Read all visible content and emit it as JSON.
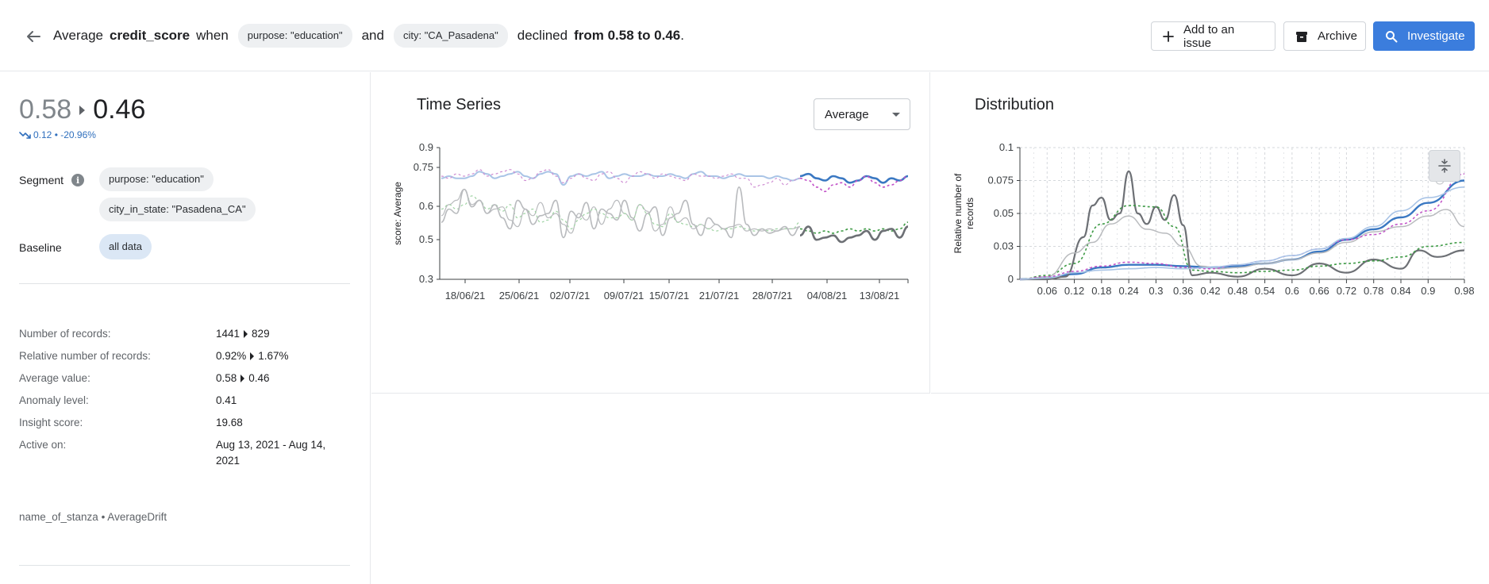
{
  "header": {
    "prefix": "Average",
    "metric": "credit_score",
    "when": "when",
    "chip1": "purpose: \"education\"",
    "and": "and",
    "chip2": "city: \"CA_Pasadena\"",
    "declined": "declined",
    "change": "from 0.58 to 0.46",
    "period": ".",
    "actions": {
      "add_issue": "Add to an issue",
      "archive": "Archive",
      "investigate": "Investigate"
    }
  },
  "summary": {
    "old_value": "0.58",
    "new_value": "0.46",
    "delta": "0.12 • -20.96%",
    "segment_label": "Segment",
    "segment_info_icon": "info-icon",
    "segments": [
      "purpose: \"education\"",
      "city_in_state: \"Pasadena_CA\""
    ],
    "baseline_label": "Baseline",
    "baseline": "all data"
  },
  "stats": {
    "records_label": "Number of records:",
    "records_old": "1441",
    "records_new": "829",
    "relative_label": "Relative number of records:",
    "relative_old": "0.92%",
    "relative_new": "1.67%",
    "avg_label": "Average value:",
    "avg_old": "0.58",
    "avg_new": "0.46",
    "anomaly_label": "Anomaly level:",
    "anomaly": "0.41",
    "insight_label": "Insight score:",
    "insight": "19.68",
    "active_label": "Active on:",
    "active": "Aug 13, 2021 - Aug 14, 2021"
  },
  "stanza": "name_of_stanza • AverageDrift",
  "colors": {
    "accent": "#3b7ddd",
    "segment_line": "#3a78c2",
    "baseline_line": "#a9c4e6",
    "magenta": "#c14fc7",
    "green": "#3f9b46",
    "gray": "#6d7075",
    "lightgray": "#b9bbbe"
  },
  "chart_data": [
    {
      "type": "line",
      "title": "Time Series",
      "aggregation": "Average",
      "ylabel": "score: Average",
      "ylim": [
        0.3,
        0.9
      ],
      "yticks": [
        "0.3",
        "0.5",
        "0.6",
        "0.75",
        "0.9"
      ],
      "ytick_values": [
        0.3,
        0.5,
        0.6,
        0.75,
        0.9
      ],
      "xticks": [
        "18/06/21",
        "25/06/21",
        "02/07/21",
        "09/07/21",
        "15/07/21",
        "21/07/21",
        "28/07/21",
        "04/08/21",
        "13/08/21"
      ],
      "x_start": "2021-06-15",
      "x_end": "2021-08-15",
      "grid": false,
      "series": [
        {
          "style": "baseline-avg",
          "values": [
            0.76,
            0.77,
            0.76,
            0.76,
            0.77,
            0.79,
            0.78,
            0.76,
            0.77,
            0.78,
            0.79,
            0.77,
            0.76,
            0.78,
            0.79,
            0.78,
            0.73,
            0.77,
            0.78,
            0.77,
            0.78,
            0.79,
            0.76,
            0.77,
            0.78,
            0.77,
            0.77,
            0.78,
            0.77,
            0.77,
            0.78,
            0.77,
            0.76,
            0.78,
            0.79,
            0.77,
            0.77,
            0.76,
            0.77,
            0.78,
            0.77,
            0.77,
            0.77,
            0.76,
            0.77,
            0.76,
            0.75,
            0.76
          ]
        },
        {
          "style": "segment-avg",
          "values": [
            0.77,
            0.76,
            0.78,
            0.77,
            0.78,
            0.8,
            0.77,
            0.78,
            0.79,
            0.8,
            0.78,
            0.75,
            0.76,
            0.79,
            0.8,
            0.77,
            0.74,
            0.76,
            0.78,
            0.76,
            0.75,
            0.78,
            0.79,
            0.76,
            0.74,
            0.77,
            0.79,
            0.78,
            0.76,
            0.78,
            0.77,
            0.76,
            0.75,
            0.78,
            0.77,
            0.77,
            0.76,
            0.77,
            0.78,
            0.76,
            0.76,
            0.72,
            0.73,
            0.74,
            0.76,
            0.73,
            0.75,
            0.76
          ]
        },
        {
          "style": "baseline-count",
          "values": [
            0.59,
            0.64,
            0.66,
            0.71,
            0.64,
            0.66,
            0.6,
            0.62,
            0.63,
            0.57,
            0.54,
            0.62,
            0.59,
            0.65,
            0.58,
            0.6,
            0.55,
            0.51,
            0.6,
            0.57,
            0.63,
            0.55,
            0.62,
            0.66,
            0.6,
            0.57,
            0.64,
            0.61,
            0.52,
            0.55,
            0.63,
            0.56,
            0.58,
            0.53,
            0.55,
            0.53,
            0.55,
            0.53,
            0.54,
            0.55,
            0.52,
            0.53,
            0.52,
            0.53,
            0.52,
            0.53,
            0.53,
            0.54
          ]
        },
        {
          "style": "segment-count",
          "values": [
            0.62,
            0.64,
            0.62,
            0.64,
            0.68,
            0.66,
            0.62,
            0.64,
            0.61,
            0.64,
            0.58,
            0.6,
            0.62,
            0.56,
            0.57,
            0.61,
            0.57,
            0.53,
            0.57,
            0.6,
            0.62,
            0.6,
            0.58,
            0.58,
            0.6,
            0.57,
            0.64,
            0.6,
            0.55,
            0.54,
            0.6,
            0.56,
            0.55,
            0.54,
            0.55,
            0.53,
            0.52,
            0.53,
            0.53,
            0.54,
            0.53,
            0.52,
            0.53,
            0.52,
            0.53,
            0.53,
            0.53,
            0.56
          ]
        },
        {
          "style": "baseline-gray",
          "values": [
            0.56,
            0.62,
            0.6,
            0.71,
            0.63,
            0.66,
            0.6,
            0.64,
            0.58,
            0.53,
            0.66,
            0.62,
            0.55,
            0.59,
            0.6,
            0.66,
            0.49,
            0.61,
            0.58,
            0.65,
            0.53,
            0.62,
            0.6,
            0.57,
            0.66,
            0.58,
            0.52,
            0.6,
            0.63,
            0.5,
            0.58,
            0.6,
            0.66,
            0.55,
            0.5,
            0.58,
            0.55,
            0.53,
            0.49,
            0.72,
            0.55,
            0.5,
            0.53,
            0.51,
            0.52,
            0.54,
            0.5,
            0.54
          ]
        }
      ],
      "recent": [
        {
          "style": "recent-avg",
          "values": [
            0.77,
            0.78,
            0.76,
            0.75,
            0.77,
            0.76,
            0.74,
            0.75,
            0.77,
            0.76,
            0.74,
            0.76,
            0.75,
            0.77
          ]
        },
        {
          "style": "recent-magenta",
          "values": [
            0.76,
            0.75,
            0.72,
            0.7,
            0.73,
            0.74,
            0.72,
            0.75,
            0.77,
            0.74,
            0.72,
            0.73,
            0.75,
            0.77
          ]
        },
        {
          "style": "recent-green",
          "values": [
            0.53,
            0.52,
            0.51,
            0.52,
            0.51,
            0.52,
            0.53,
            0.52,
            0.53,
            0.52,
            0.53,
            0.52,
            0.53,
            0.56
          ]
        },
        {
          "style": "recent-gray",
          "values": [
            0.5,
            0.54,
            0.48,
            0.49,
            0.5,
            0.47,
            0.49,
            0.5,
            0.52,
            0.48,
            0.52,
            0.53,
            0.49,
            0.54
          ]
        }
      ]
    },
    {
      "type": "line",
      "title": "Distribution",
      "ylabel": "Relative number of records",
      "ylim": [
        0,
        0.1
      ],
      "yticks": [
        "0",
        "0.03",
        "0.05",
        "0.075",
        "0.1"
      ],
      "ytick_values": [
        0,
        0.025,
        0.05,
        0.075,
        0.1
      ],
      "xticks": [
        "0.06",
        "0.12",
        "0.18",
        "0.24",
        "0.3",
        "0.36",
        "0.42",
        "0.48",
        "0.54",
        "0.6",
        "0.66",
        "0.72",
        "0.78",
        "0.84",
        "0.9",
        "0.98"
      ],
      "xtick_values": [
        0.06,
        0.12,
        0.18,
        0.24,
        0.3,
        0.36,
        0.42,
        0.48,
        0.54,
        0.6,
        0.66,
        0.72,
        0.78,
        0.84,
        0.9,
        0.98
      ],
      "xlim": [
        0.0,
        0.98
      ],
      "grid": true,
      "zoom_icon": "zoom-icon",
      "series": [
        {
          "style": "blue",
          "x": [
            0.0,
            0.06,
            0.12,
            0.18,
            0.24,
            0.3,
            0.36,
            0.42,
            0.48,
            0.54,
            0.6,
            0.66,
            0.72,
            0.78,
            0.84,
            0.9,
            0.98
          ],
          "values": [
            0.0,
            0.001,
            0.004,
            0.009,
            0.011,
            0.011,
            0.01,
            0.009,
            0.01,
            0.012,
            0.015,
            0.021,
            0.03,
            0.038,
            0.047,
            0.058,
            0.075
          ]
        },
        {
          "style": "dark",
          "x": [
            0.0,
            0.06,
            0.1,
            0.14,
            0.16,
            0.18,
            0.2,
            0.22,
            0.24,
            0.26,
            0.28,
            0.3,
            0.32,
            0.34,
            0.36,
            0.38,
            0.42,
            0.48,
            0.54,
            0.6,
            0.66,
            0.72,
            0.78,
            0.84,
            0.88,
            0.92,
            0.98
          ],
          "values": [
            0.0,
            0.0,
            0.002,
            0.032,
            0.056,
            0.062,
            0.045,
            0.05,
            0.082,
            0.05,
            0.042,
            0.055,
            0.045,
            0.064,
            0.041,
            0.003,
            0.005,
            0.002,
            0.008,
            0.003,
            0.012,
            0.005,
            0.015,
            0.008,
            0.022,
            0.017,
            0.022
          ]
        },
        {
          "style": "green",
          "x": [
            0.0,
            0.06,
            0.12,
            0.18,
            0.24,
            0.3,
            0.34,
            0.38,
            0.42,
            0.48,
            0.54,
            0.6,
            0.66,
            0.72,
            0.78,
            0.84,
            0.9,
            0.98
          ],
          "values": [
            0.0,
            0.003,
            0.012,
            0.042,
            0.056,
            0.055,
            0.04,
            0.007,
            0.006,
            0.005,
            0.006,
            0.007,
            0.01,
            0.012,
            0.014,
            0.017,
            0.025,
            0.028
          ]
        },
        {
          "style": "lightgray",
          "x": [
            0.0,
            0.06,
            0.12,
            0.16,
            0.2,
            0.24,
            0.28,
            0.32,
            0.36,
            0.4,
            0.44,
            0.48,
            0.54,
            0.6,
            0.66,
            0.72,
            0.78,
            0.84,
            0.9,
            0.94,
            0.98
          ],
          "values": [
            0.0,
            0.002,
            0.02,
            0.028,
            0.042,
            0.048,
            0.038,
            0.035,
            0.025,
            0.01,
            0.008,
            0.009,
            0.012,
            0.015,
            0.02,
            0.028,
            0.036,
            0.04,
            0.048,
            0.053,
            0.04
          ]
        },
        {
          "style": "magenta",
          "x": [
            0.0,
            0.06,
            0.12,
            0.18,
            0.24,
            0.3,
            0.36,
            0.42,
            0.48,
            0.54,
            0.6,
            0.66,
            0.72,
            0.78,
            0.84,
            0.9,
            0.98
          ],
          "values": [
            0.0,
            0.002,
            0.006,
            0.01,
            0.013,
            0.012,
            0.009,
            0.008,
            0.011,
            0.014,
            0.018,
            0.023,
            0.03,
            0.034,
            0.042,
            0.052,
            0.08
          ]
        },
        {
          "style": "paleblue",
          "x": [
            0.0,
            0.06,
            0.12,
            0.18,
            0.24,
            0.3,
            0.36,
            0.42,
            0.48,
            0.54,
            0.6,
            0.66,
            0.72,
            0.78,
            0.84,
            0.9,
            0.98
          ],
          "values": [
            0.0,
            0.001,
            0.005,
            0.007,
            0.008,
            0.009,
            0.008,
            0.009,
            0.011,
            0.014,
            0.018,
            0.023,
            0.031,
            0.04,
            0.052,
            0.062,
            0.07
          ]
        }
      ]
    }
  ]
}
